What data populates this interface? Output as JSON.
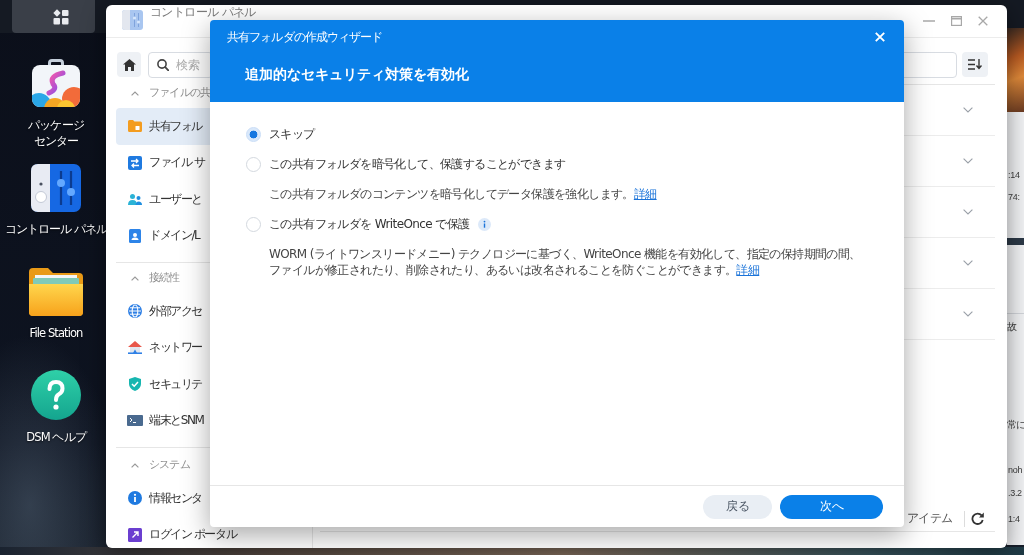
{
  "desktop": {
    "icons": [
      {
        "kind": "package",
        "lines": [
          "パッケージ",
          "センター"
        ]
      },
      {
        "kind": "control",
        "lines": [
          "コントロール パネル"
        ]
      },
      {
        "kind": "folder",
        "lines": [
          "File Station"
        ]
      },
      {
        "kind": "help",
        "lines": [
          "DSM ヘルプ"
        ]
      }
    ]
  },
  "control_panel": {
    "title": "コントロール パネル",
    "sidebar": {
      "search": {
        "placeholder": "検索"
      },
      "sections": [
        {
          "title": "ファイルの共",
          "expanded": true,
          "items": [
            {
              "kind": "folder",
              "label": "共有フォル",
              "selected": true
            },
            {
              "kind": "file-services",
              "label": "ファイル サ",
              "selected": false
            },
            {
              "kind": "users",
              "label": "ユーザーと",
              "selected": false
            },
            {
              "kind": "domain",
              "label": "ドメイン/L",
              "selected": false
            }
          ]
        },
        {
          "title": "接続性",
          "expanded": true,
          "items": [
            {
              "kind": "external",
              "label": "外部アクセ",
              "selected": false
            },
            {
              "kind": "network",
              "label": "ネットワー",
              "selected": false
            },
            {
              "kind": "security",
              "label": "セキュリテ",
              "selected": false
            },
            {
              "kind": "terminal",
              "label": "端末とSNM",
              "selected": false
            }
          ]
        },
        {
          "title": "システム",
          "expanded": true,
          "items": [
            {
              "kind": "info",
              "label": "情報センタ",
              "selected": false
            },
            {
              "kind": "login",
              "label": "ログイン ポータル",
              "selected": false
            }
          ]
        }
      ]
    },
    "main": {
      "rows": [
        {
          "expanded": false
        },
        {
          "expanded": false
        },
        {
          "expanded": false
        },
        {
          "expanded": false
        },
        {
          "expanded": false
        }
      ],
      "status": "アイテム"
    }
  },
  "dialog": {
    "title": "共有フォルダの作成ウィザード",
    "heading": "追加的なセキュリティ対策を有効化",
    "options": [
      {
        "label": "スキップ",
        "selected": true
      },
      {
        "label": "この共有フォルダを暗号化して、保護することができます",
        "selected": false,
        "description": {
          "lines": [
            "この共有フォルダのコンテンツを暗号化してデータ保護を強化します。"
          ],
          "link": "詳細"
        }
      },
      {
        "label": "この共有フォルダを WriteOnce で保護",
        "selected": false,
        "info": true,
        "description": {
          "lines": [
            "WORM (ライトワンスリードメニー) テクノロジーに基づく、WriteOnce 機能を有効化して、指定の保持期間の間、",
            "ファイルが修正されたり、削除されたり、あるいは改名されることを防ぐことができます。"
          ],
          "link": "詳細"
        }
      }
    ],
    "buttons": [
      {
        "kind": "secondary",
        "label": "戻る"
      },
      {
        "kind": "primary",
        "label": "次へ"
      }
    ]
  },
  "background_window": {
    "texts": [
      ":14",
      "74:",
      "故",
      "常に",
      "noh",
      ".3.2",
      "1:4"
    ]
  }
}
